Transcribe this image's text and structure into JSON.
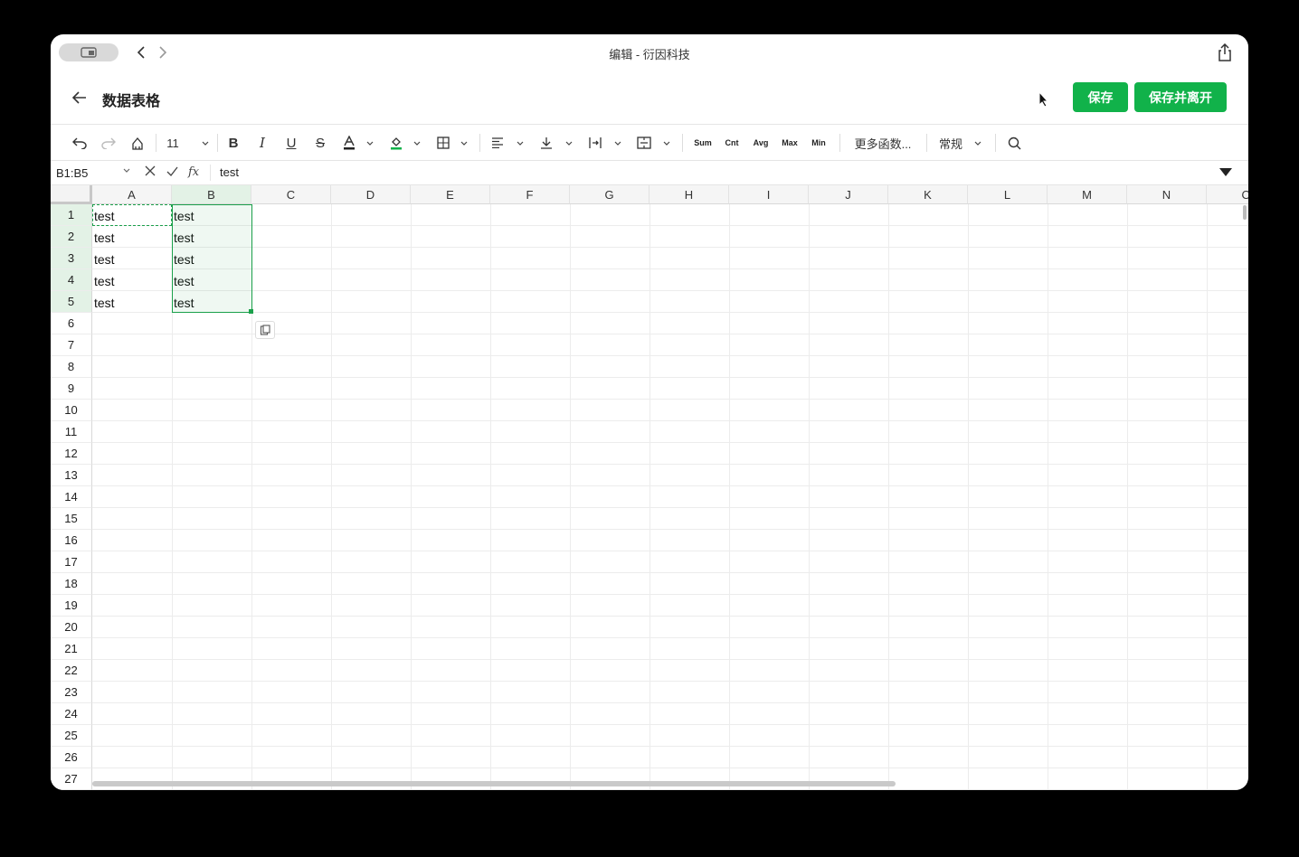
{
  "window": {
    "title": "编辑 - 衍因科技"
  },
  "header": {
    "title": "数据表格",
    "save_label": "保存",
    "save_leave_label": "保存并离开"
  },
  "toolbar": {
    "font_size": "11",
    "functions": [
      "Sum",
      "Cnt",
      "Avg",
      "Max",
      "Min"
    ],
    "more_functions": "更多函数...",
    "format": "常规"
  },
  "formula": {
    "name_box": "B1:B5",
    "fx": "fx",
    "value": "test"
  },
  "colors": {
    "accent": "#11b24a",
    "selection": "#1aa04a"
  },
  "sheet": {
    "columns": [
      "A",
      "B",
      "C",
      "D",
      "E",
      "F",
      "G",
      "H",
      "I",
      "J",
      "K",
      "L",
      "M",
      "N",
      "O"
    ],
    "rows": [
      "1",
      "2",
      "3",
      "4",
      "5",
      "6",
      "7",
      "8",
      "9",
      "10",
      "11",
      "12",
      "13",
      "14",
      "15",
      "16",
      "17",
      "18",
      "19",
      "20",
      "21",
      "22",
      "23",
      "24",
      "25",
      "26",
      "27"
    ],
    "cells": {
      "A": [
        "test",
        "test",
        "test",
        "test",
        "test"
      ],
      "B": [
        "test",
        "test",
        "test",
        "test",
        "test"
      ]
    }
  }
}
